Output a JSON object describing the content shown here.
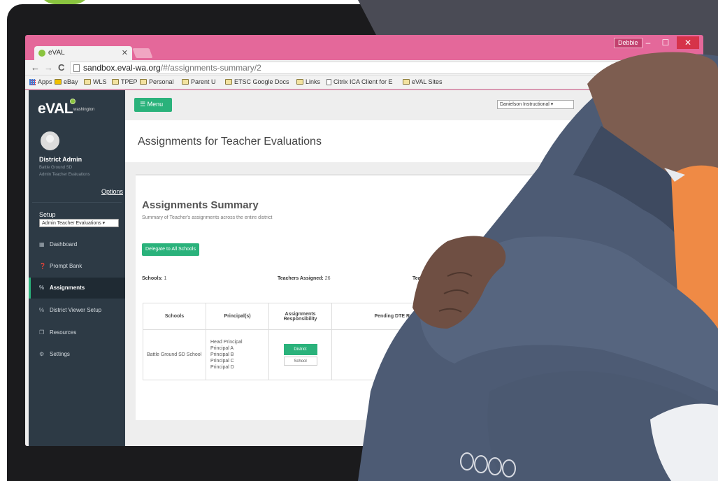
{
  "browser": {
    "tab_title": "eVAL",
    "user_badge": "Debbie",
    "url_host": "sandbox.eval-wa.org",
    "url_path": "/#/assignments-summary/2",
    "bookmarks": [
      "Apps",
      "eBay",
      "WLS",
      "TPEP",
      "Personal",
      "Parent U",
      "ETSC Google Docs",
      "Links",
      "Citrix ICA Client for E",
      "eVAL Sites"
    ]
  },
  "sidebar": {
    "brand": "eVAL",
    "brand_sub": "washington",
    "user_name": "District Admin",
    "district": "Battle Ground SD",
    "role": "Admin Teacher Evaluations",
    "options_link": "Options",
    "setup_label": "Setup",
    "setup_select": "Admin Teacher Evaluations",
    "items": [
      {
        "label": "Dashboard",
        "icon": "dashboard-icon",
        "glyph": "▦"
      },
      {
        "label": "Prompt Bank",
        "icon": "question-icon",
        "glyph": "❓"
      },
      {
        "label": "Assignments",
        "icon": "link-icon",
        "glyph": "%"
      },
      {
        "label": "District Viewer Setup",
        "icon": "link-icon",
        "glyph": "%"
      },
      {
        "label": "Resources",
        "icon": "copy-icon",
        "glyph": "❐"
      },
      {
        "label": "Settings",
        "icon": "gears-icon",
        "glyph": "⚙"
      }
    ]
  },
  "topbar": {
    "menu_label": "Menu",
    "framework_select": "Danielson Instructional"
  },
  "page": {
    "title": "Assignments for Teacher Evaluations"
  },
  "summary": {
    "title": "Assignments Summary",
    "subtitle": "Summary of Teacher's assignments across the entire district",
    "delegate_button": "Delegate to All Schools",
    "schools_label": "Schools:",
    "schools_value": "1",
    "teachers_assigned_label": "Teachers Assigned:",
    "teachers_assigned_value": "26",
    "third_stat_partial": "Teache",
    "table": {
      "headers": [
        "Schools",
        "Principal(s)",
        "Assignments Responsibility",
        "Pending DTE Requests"
      ],
      "rows": [
        {
          "school": "Battle Ground SD School",
          "principals": [
            "Head Principal",
            "Principal A",
            "Principal B",
            "Principal C",
            "Principal D"
          ],
          "btn_district": "District",
          "btn_school": "School"
        }
      ]
    }
  },
  "colors": {
    "window_frame": "#e4689a",
    "accent_green": "#2ab27b",
    "sidebar_bg": "#2d3a45"
  }
}
